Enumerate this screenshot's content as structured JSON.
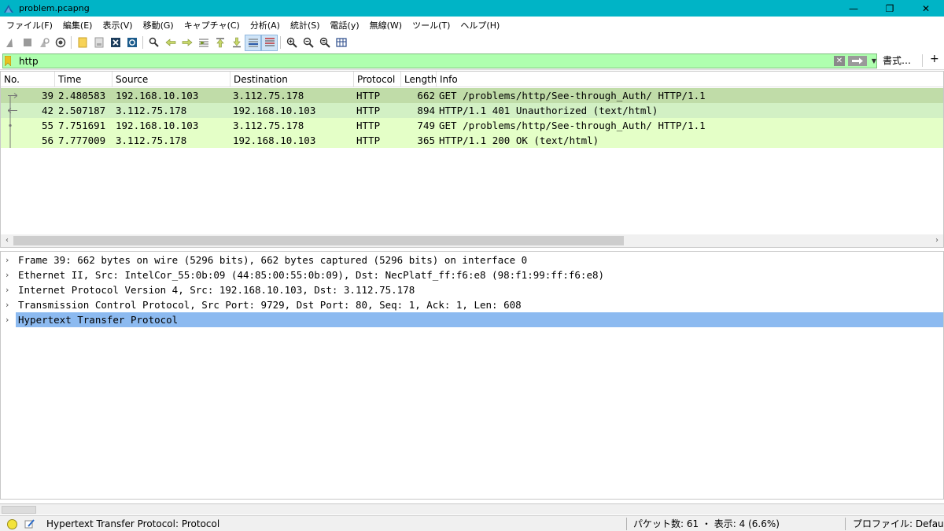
{
  "window": {
    "title": "problem.pcapng",
    "minimize": "—",
    "restore": "❐",
    "close": "✕"
  },
  "menu": [
    "ファイル(F)",
    "編集(E)",
    "表示(V)",
    "移動(G)",
    "キャプチャ(C)",
    "分析(A)",
    "統計(S)",
    "電話(y)",
    "無線(W)",
    "ツール(T)",
    "ヘルプ(H)"
  ],
  "filter": {
    "value": "http",
    "clear_glyph": "✕",
    "dropdown_glyph": "▼",
    "format_label": "書式…",
    "add_glyph": "+"
  },
  "packet_list": {
    "columns": [
      "No.",
      "Time",
      "Source",
      "Destination",
      "Protocol",
      "Length",
      "Info"
    ],
    "rows": [
      {
        "no": "39",
        "time": "2.480583",
        "source": "192.168.10.103",
        "destination": "3.112.75.178",
        "protocol": "HTTP",
        "length": "662",
        "info": "GET /problems/http/See-through_Auth/ HTTP/1.1",
        "bg": "#c0dca8",
        "selected": true
      },
      {
        "no": "42",
        "time": "2.507187",
        "source": "3.112.75.178",
        "destination": "192.168.10.103",
        "protocol": "HTTP",
        "length": "894",
        "info": "HTTP/1.1 401 Unauthorized  (text/html)",
        "bg": "#d2f0c4",
        "selected": false
      },
      {
        "no": "55",
        "time": "7.751691",
        "source": "192.168.10.103",
        "destination": "3.112.75.178",
        "protocol": "HTTP",
        "length": "749",
        "info": "GET /problems/http/See-through_Auth/ HTTP/1.1",
        "bg": "#e4ffc7",
        "selected": false
      },
      {
        "no": "56",
        "time": "7.777009",
        "source": "3.112.75.178",
        "destination": "192.168.10.103",
        "protocol": "HTTP",
        "length": "365",
        "info": "HTTP/1.1 200 OK  (text/html)",
        "bg": "#e4ffc7",
        "selected": false
      }
    ]
  },
  "details": [
    {
      "text": "Frame 39: 662 bytes on wire (5296 bits), 662 bytes captured (5296 bits) on interface 0",
      "selected": false
    },
    {
      "text": "Ethernet II, Src: IntelCor_55:0b:09 (44:85:00:55:0b:09), Dst: NecPlatf_ff:f6:e8 (98:f1:99:ff:f6:e8)",
      "selected": false
    },
    {
      "text": "Internet Protocol Version 4, Src: 192.168.10.103, Dst: 3.112.75.178",
      "selected": false
    },
    {
      "text": "Transmission Control Protocol, Src Port: 9729, Dst Port: 80, Seq: 1, Ack: 1, Len: 608",
      "selected": false
    },
    {
      "text": "Hypertext Transfer Protocol",
      "selected": true
    }
  ],
  "chevron": "›",
  "scroll": {
    "left": "‹",
    "right": "›"
  },
  "status": {
    "field": "Hypertext Transfer Protocol: Protocol",
    "packets": "パケット数: 61 ・ 表示: 4 (6.6%)",
    "profile": "プロファイル: Default"
  },
  "colors": {
    "titlebar": "#00b4c6",
    "filter_valid": "#afffaf",
    "selected_detail": "#8cbaf0"
  },
  "toolbar_icons": [
    "shark-fin-start-icon",
    "stop-icon",
    "restart-icon",
    "capture-options-icon",
    "open-file-icon",
    "save-file-icon",
    "close-file-icon",
    "reload-icon",
    "find-icon",
    "go-back-icon",
    "go-forward-icon",
    "go-to-packet-icon",
    "go-first-icon",
    "go-last-icon",
    "autoscroll-icon",
    "colorize-icon",
    "zoom-in-icon",
    "zoom-out-icon",
    "zoom-normal-icon",
    "resize-columns-icon"
  ]
}
